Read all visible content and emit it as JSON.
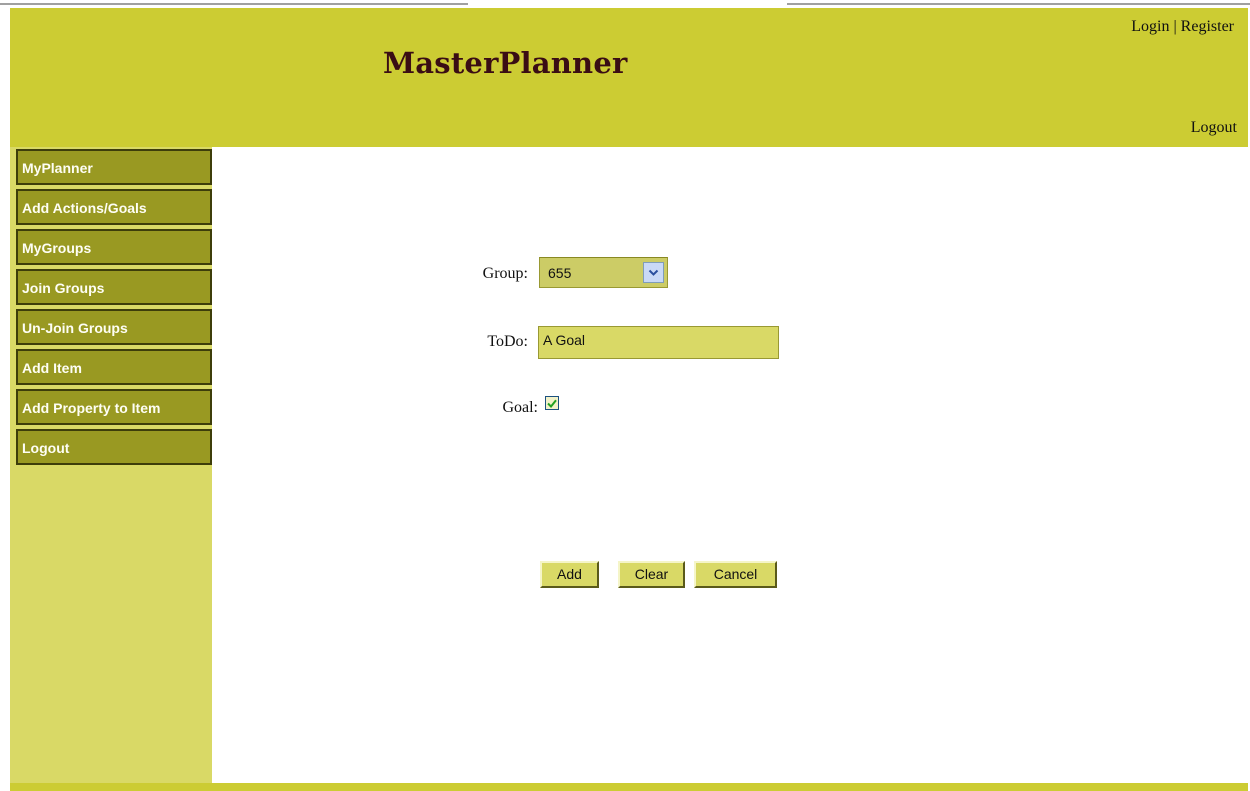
{
  "header": {
    "title": "MasterPlanner",
    "login_label": "Login",
    "separator": " | ",
    "register_label": "Register",
    "logout_label": "Logout"
  },
  "sidebar": {
    "items": [
      {
        "label": "MyPlanner"
      },
      {
        "label": "Add Actions/Goals"
      },
      {
        "label": "MyGroups"
      },
      {
        "label": "Join Groups"
      },
      {
        "label": "Un-Join Groups"
      },
      {
        "label": "Add Item"
      },
      {
        "label": "Add Property to Item"
      },
      {
        "label": "Logout"
      }
    ]
  },
  "form": {
    "group_label": "Group:",
    "group_value": "655",
    "todo_label": "ToDo:",
    "todo_value": "A Goal",
    "goal_label": "Goal:",
    "goal_checked": true
  },
  "buttons": {
    "add": "Add",
    "clear": "Clear",
    "cancel": "Cancel"
  },
  "colors": {
    "header_bg": "#cccc33",
    "sidebar_bg": "#d9d966",
    "nav_item_bg": "#999922",
    "title_color": "#3a0d14"
  },
  "icons": {
    "dropdown": "chevron-down-icon",
    "checkbox": "check-icon"
  }
}
